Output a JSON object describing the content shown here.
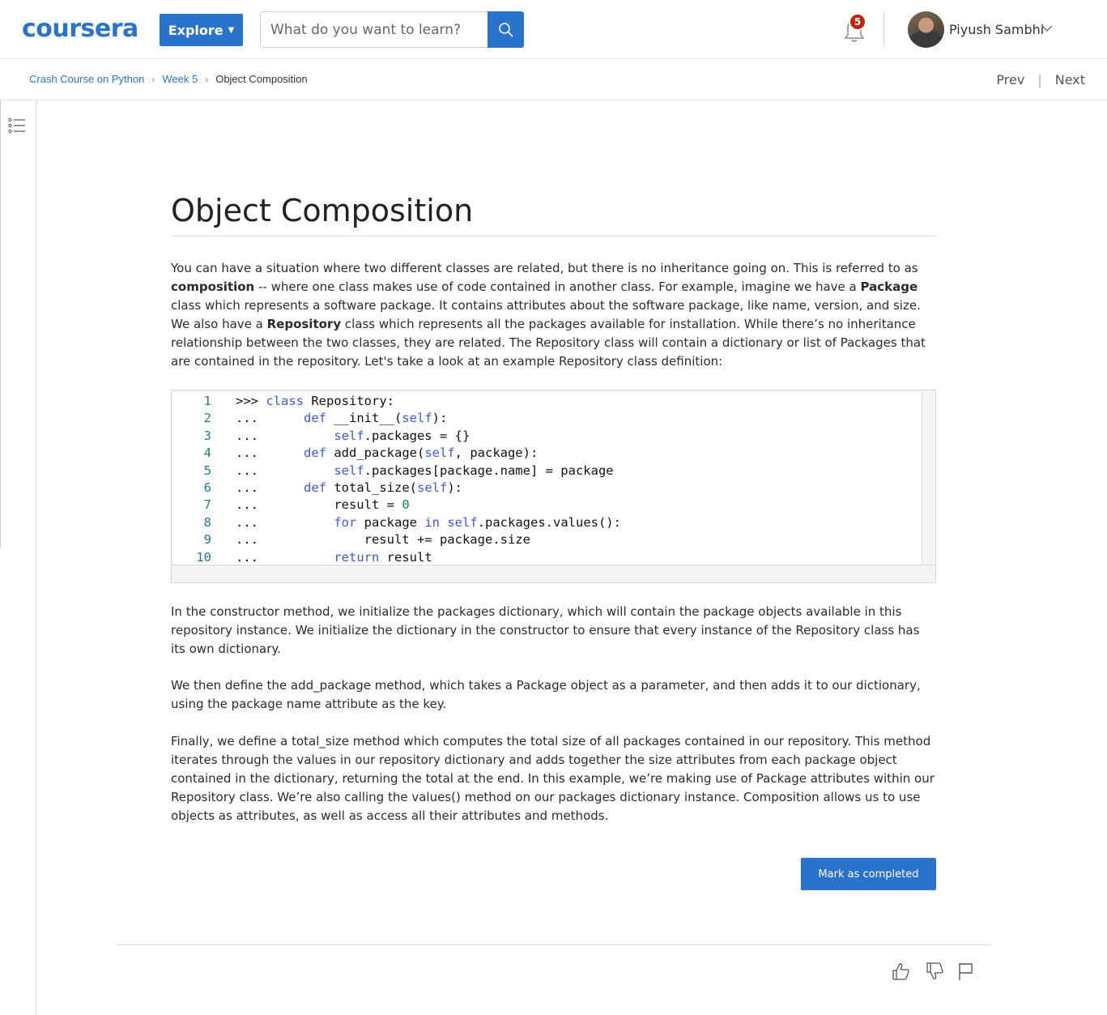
{
  "header": {
    "logo": "coursera",
    "explore_label": "Explore",
    "search_placeholder": "What do you want to learn?",
    "notification_count": "5",
    "user_name": "Piyush Sambhi"
  },
  "breadcrumb": {
    "items": [
      "Crash Course on Python",
      "Week 5"
    ],
    "current": "Object Composition"
  },
  "nav": {
    "prev": "Prev",
    "divider": "|",
    "next": "Next"
  },
  "page": {
    "title": "Object Composition",
    "intro": {
      "t1": "You can have a situation where two different classes are related, but there is no inheritance going on. This is referred to as ",
      "b1": "composition",
      "t2": " -- where one class makes use of code contained in another class. For example, imagine we have a ",
      "b2": "Package",
      "t3": " class which represents a software package. It contains attributes about the software package, like name, version, and size. We also have a ",
      "b3": "Repository",
      "t4": " class which represents all the packages available for installation. While there’s no inheritance relationship between the two classes, they are related. The Repository class will contain a dictionary or list of Packages that are contained in the repository. Let's take a look at an example Repository class definition:"
    },
    "code_lines": [
      {
        "n": "1",
        "html": ">>> <span class=\"kw\">class</span> Repository:"
      },
      {
        "n": "2",
        "html": "...      <span class=\"kw\">def</span> __init__(<span class=\"kw\">self</span>):"
      },
      {
        "n": "3",
        "html": "...          <span class=\"kw\">self</span>.packages = {}"
      },
      {
        "n": "4",
        "html": "...      <span class=\"kw\">def</span> add_package(<span class=\"kw\">self</span>, package):"
      },
      {
        "n": "5",
        "html": "...          <span class=\"kw\">self</span>.packages[package.name] = package"
      },
      {
        "n": "6",
        "html": "...      <span class=\"kw\">def</span> total_size(<span class=\"kw\">self</span>):"
      },
      {
        "n": "7",
        "html": "...          result = <span class=\"nm\">0</span>"
      },
      {
        "n": "8",
        "html": "...          <span class=\"kw\">for</span> package <span class=\"kw\">in</span> <span class=\"kw\">self</span>.packages.values():"
      },
      {
        "n": "9",
        "html": "...              result += package.size"
      },
      {
        "n": "10",
        "html": "...          <span class=\"kw\">return</span> result"
      }
    ],
    "para2": "In the constructor method, we initialize the packages dictionary, which will contain the package objects available in this repository instance. We initialize the dictionary in the constructor to ensure that every instance of the Repository class has its own dictionary.",
    "para3": "We then define the add_package method, which takes a Package object as a parameter, and then adds it to our dictionary, using the package name attribute as the key.",
    "para4": "Finally, we define a total_size method which computes the total size of all packages contained in our repository. This method iterates through the values in our repository dictionary and adds together the size attributes from each package object contained in the dictionary, returning the total at the end. In this example, we’re making use of Package attributes within our Repository class. We’re also calling the values() method on our packages dictionary instance. Composition allows us to use objects as attributes, as well as access all their attributes and methods.",
    "complete_button": "Mark as completed"
  },
  "icons": {
    "search": "search-icon",
    "bell": "bell-icon",
    "toc": "list-icon",
    "like": "thumbs-up-icon",
    "dislike": "thumbs-down-icon",
    "flag": "flag-icon"
  },
  "colors": {
    "brand": "#2a73cc",
    "badge": "#c4220f",
    "keyword": "#3b5bdb",
    "number": "#098658",
    "line_number": "#237893"
  }
}
